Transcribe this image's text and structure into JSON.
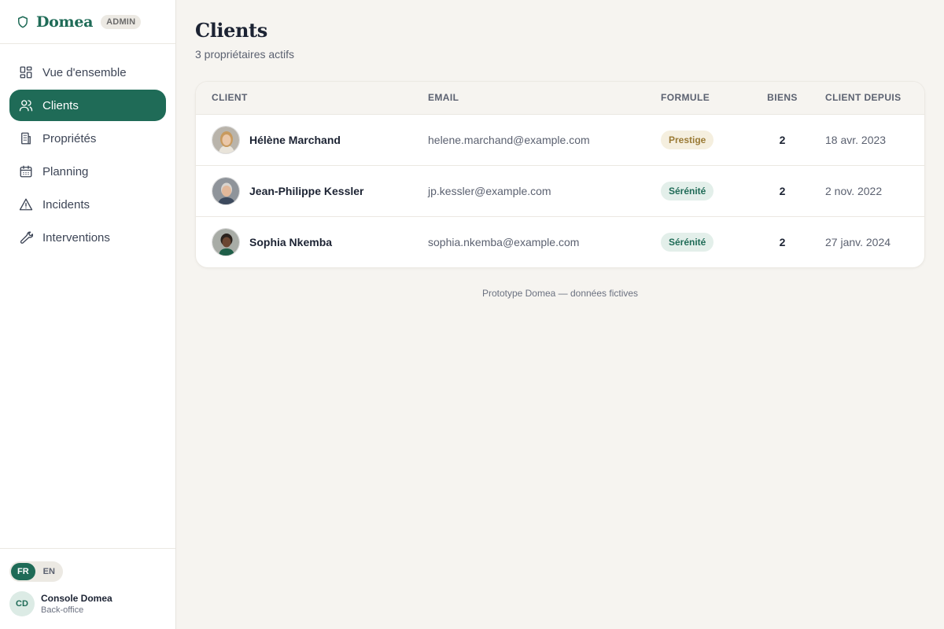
{
  "brand": {
    "name": "Domea",
    "badge": "ADMIN",
    "accent": "#1f6b57"
  },
  "nav": [
    {
      "label": "Vue d'ensemble",
      "icon": "dashboard-icon",
      "active": false
    },
    {
      "label": "Clients",
      "icon": "users-icon",
      "active": true
    },
    {
      "label": "Propriétés",
      "icon": "building-icon",
      "active": false
    },
    {
      "label": "Planning",
      "icon": "calendar-icon",
      "active": false
    },
    {
      "label": "Incidents",
      "icon": "warning-icon",
      "active": false
    },
    {
      "label": "Interventions",
      "icon": "wrench-icon",
      "active": false
    }
  ],
  "language": {
    "options": [
      "FR",
      "EN"
    ],
    "selected": "FR"
  },
  "user": {
    "initials": "CD",
    "name": "Console Domea",
    "role": "Back-office"
  },
  "page": {
    "title": "Clients",
    "subtitle": "3 propriétaires actifs"
  },
  "table": {
    "headers": {
      "client": "CLIENT",
      "email": "EMAIL",
      "formule": "FORMULE",
      "biens": "BIENS",
      "depuis": "CLIENT DEPUIS"
    },
    "rows": [
      {
        "name": "Hélène Marchand",
        "email": "helene.marchand@example.com",
        "formule": "Prestige",
        "biens": "2",
        "depuis": "18 avr. 2023"
      },
      {
        "name": "Jean-Philippe Kessler",
        "email": "jp.kessler@example.com",
        "formule": "Sérénité",
        "biens": "2",
        "depuis": "2 nov. 2022"
      },
      {
        "name": "Sophia Nkemba",
        "email": "sophia.nkemba@example.com",
        "formule": "Sérénité",
        "biens": "2",
        "depuis": "27 janv. 2024"
      }
    ]
  },
  "footer": {
    "note": "Prototype Domea — données fictives"
  }
}
